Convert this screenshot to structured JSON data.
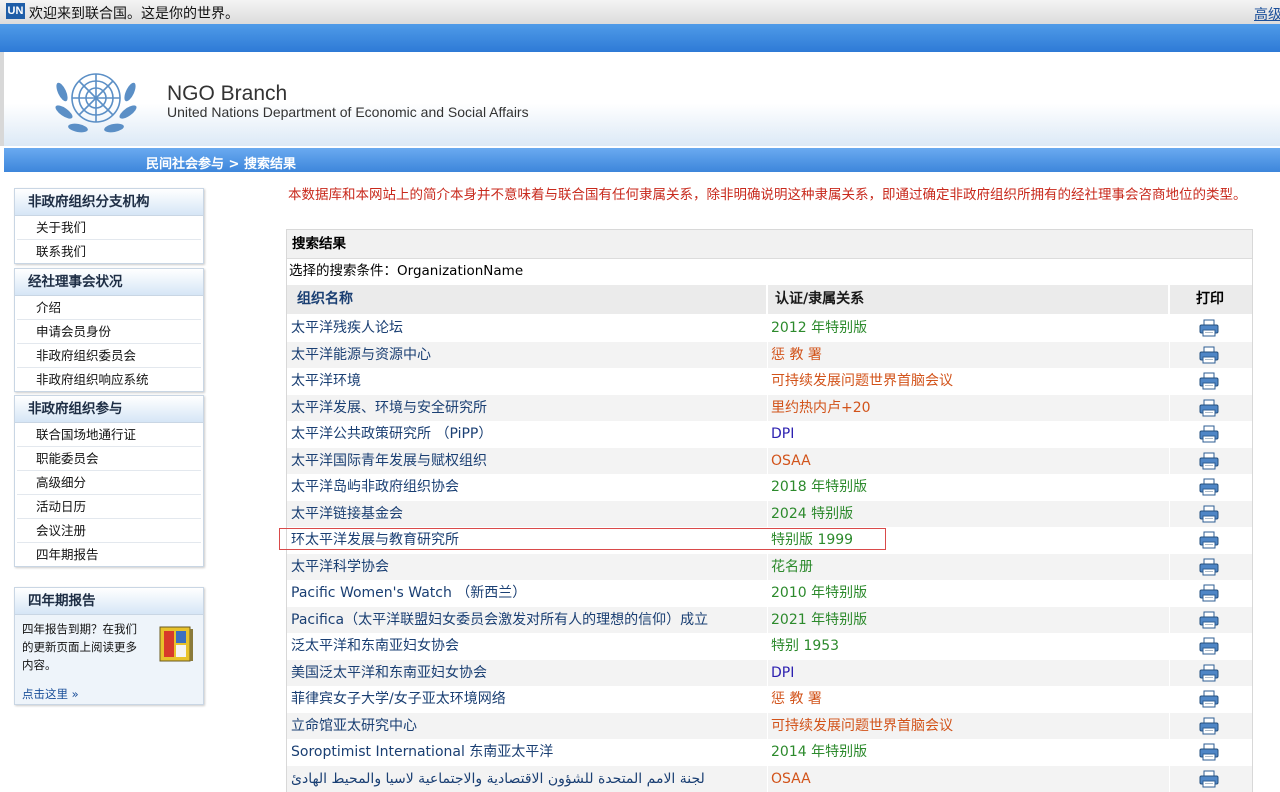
{
  "topbar": {
    "logo": "UN",
    "welcome": "欢迎来到联合国。这是你的世界。",
    "adv_link": "高级"
  },
  "header": {
    "title": "NGO Branch",
    "subtitle": "United Nations Department of Economic and Social Affairs"
  },
  "breadcrumb": "民间社会参与 > 搜索结果",
  "sidebar": {
    "sections": [
      {
        "title": "非政府组织分支机构",
        "items": [
          "关于我们",
          "联系我们"
        ]
      },
      {
        "title": "经社理事会状况",
        "items": [
          "介绍",
          "申请会员身份",
          "非政府组织委员会",
          "非政府组织响应系统"
        ]
      },
      {
        "title": "非政府组织参与",
        "items": [
          "联合国场地通行证",
          "职能委员会",
          "高级细分",
          "活动日历",
          "会议注册",
          "四年期报告"
        ]
      }
    ],
    "quad": {
      "title": "四年期报告",
      "text": "四年报告到期？在我们的更新页面上阅读更多内容。",
      "link": "点击这里 »"
    }
  },
  "main": {
    "disclaimer": "本数据库和本网站上的简介本身并不意味着与联合国有任何隶属关系，除非明确说明这种隶属关系，即通过确定非政府组织所拥有的经社理事会咨商地位的类型。",
    "results_title": "搜索结果",
    "criteria": "选择的搜索条件：OrganizationName",
    "columns": {
      "name": "组织名称",
      "affiliation": "认证/隶属关系",
      "print": "打印"
    },
    "rows": [
      {
        "name": "太平洋残疾人论坛",
        "aff": "2012 年特别版",
        "color": "#2c8a2c"
      },
      {
        "name": "太平洋能源与资源中心",
        "aff": "惩 教 署",
        "color": "#d2531a"
      },
      {
        "name": "太平洋环境",
        "aff": "可持续发展问题世界首脑会议",
        "color": "#d2531a"
      },
      {
        "name": "太平洋发展、环境与安全研究所",
        "aff": "里约热内卢+20",
        "color": "#d2531a"
      },
      {
        "name": "太平洋公共政策研究所 （PiPP）",
        "aff": "DPI",
        "color": "#2c20b0"
      },
      {
        "name": "太平洋国际青年发展与赋权组织",
        "aff": "OSAA",
        "color": "#d2531a"
      },
      {
        "name": "太平洋岛屿非政府组织协会",
        "aff": "2018 年特别版",
        "color": "#2c8a2c"
      },
      {
        "name": "太平洋链接基金会",
        "aff": "2024 特别版",
        "color": "#2c8a2c"
      },
      {
        "name": "环太平洋发展与教育研究所",
        "aff": "特别版 1999",
        "color": "#2c8a2c"
      },
      {
        "name": "太平洋科学协会",
        "aff": "花名册",
        "color": "#2c8a2c"
      },
      {
        "name": "Pacific Women's Watch （新西兰）",
        "aff": "2010 年特别版",
        "color": "#2c8a2c"
      },
      {
        "name": "Pacifica（太平洋联盟妇女委员会激发对所有人的理想的信仰）成立",
        "aff": "2021 年特别版",
        "color": "#2c8a2c"
      },
      {
        "name": "泛太平洋和东南亚妇女协会",
        "aff": "特别 1953",
        "color": "#2c8a2c"
      },
      {
        "name": "美国泛太平洋和东南亚妇女协会",
        "aff": "DPI",
        "color": "#2c20b0"
      },
      {
        "name": "菲律宾女子大学/女子亚太环境网络",
        "aff": "惩 教 署",
        "color": "#d2531a"
      },
      {
        "name": "立命馆亚太研究中心",
        "aff": "可持续发展问题世界首脑会议",
        "color": "#d2531a"
      },
      {
        "name": "Soroptimist International 东南亚太平洋",
        "aff": "2014 年特别版",
        "color": "#2c8a2c"
      },
      {
        "name": "لجنة الامم المتحدة للشؤون الاقتصادية والاجتماعية لاسيا والمحيط الهادئ",
        "aff": "OSAA",
        "color": "#d2531a"
      }
    ]
  }
}
